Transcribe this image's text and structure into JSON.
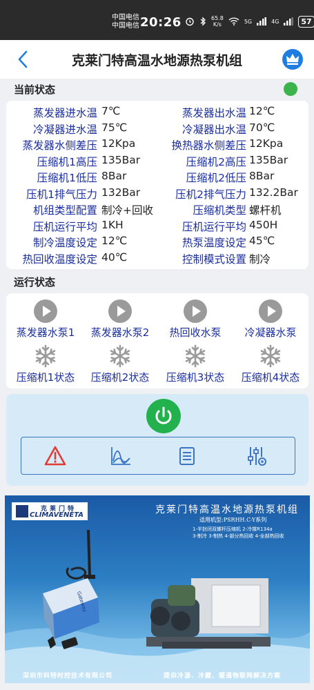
{
  "status_bar": {
    "carrier_1": "中国电信",
    "carrier_2": "中国电信",
    "time": "20:26",
    "net_speed_value": "65.8",
    "net_speed_unit": "K/s",
    "signal_5g": "5G",
    "signal_4g": "4G",
    "battery": "57"
  },
  "header": {
    "title": "克莱门特高温水地源热泵机组"
  },
  "current_status": {
    "label": "当前状态",
    "rows": [
      {
        "l1": "蒸发器进水温",
        "v1": "7℃",
        "l2": "蒸发器出水温",
        "v2": "12℃"
      },
      {
        "l1": "冷凝器进水温",
        "v1": "75℃",
        "l2": "冷凝器出水温",
        "v2": "70℃"
      },
      {
        "l1": "蒸发器水侧差压",
        "v1": "12Kpa",
        "l2": "换热器水侧差压",
        "v2": "12Kpa"
      },
      {
        "l1": "压缩机1高压",
        "v1": "135Bar",
        "l2": "压缩机2高压",
        "v2": "135Bar"
      },
      {
        "l1": "压缩机1低压",
        "v1": "8Bar",
        "l2": "压缩机2低压",
        "v2": "8Bar"
      },
      {
        "l1": "压机1排气压力",
        "v1": "132Bar",
        "l2": "压机2排气压力",
        "v2": "132.2Bar"
      },
      {
        "l1": "机组类型配置",
        "v1": "制冷+回收",
        "l2": "压缩机类型",
        "v2": "螺杆机"
      },
      {
        "l1": "压机运行平均",
        "v1": "1KH",
        "l2": "压机运行平均",
        "v2": "450H"
      },
      {
        "l1": "制冷温度设定",
        "v1": "12℃",
        "l2": "热泵温度设定",
        "v2": "45℃"
      },
      {
        "l1": "热回收温度设定",
        "v1": "40℃",
        "l2": "控制模式设置",
        "v2": "制冷"
      }
    ]
  },
  "run_status": {
    "label": "运行状态",
    "pumps": [
      {
        "label": "蒸发器水泵1",
        "icon": "play-circle-icon"
      },
      {
        "label": "蒸发器水泵2",
        "icon": "play-circle-icon"
      },
      {
        "label": "热回收水泵",
        "icon": "play-circle-icon"
      },
      {
        "label": "冷凝器水泵",
        "icon": "play-circle-icon"
      }
    ],
    "compressors": [
      {
        "label": "压缩机1状态",
        "icon": "snowflake-icon"
      },
      {
        "label": "压缩机2状态",
        "icon": "snowflake-icon"
      },
      {
        "label": "压缩机3状态",
        "icon": "snowflake-icon"
      },
      {
        "label": "压缩机4状态",
        "icon": "snowflake-icon"
      }
    ]
  },
  "controls": {
    "power_icon": "power-icon",
    "tools": [
      "alarm-icon",
      "trend-chart-icon",
      "list-icon",
      "settings-sliders-icon"
    ]
  },
  "banner": {
    "logo_cn": "克莱门特",
    "logo_en": "CLIMAVENETA",
    "title": "克莱门特高温水地源热泵机组",
    "model": "适用机型:PSRHH.C-Y系列",
    "feature_line_1": "1-半封闭双螺杆压缩机 2-冷媒R134a",
    "feature_line_2": "3-制冷 3-制热 4-部分热回收 4-全部热回收",
    "gateway_label": "Gateway",
    "company": "深圳市科特时控技术有限公司",
    "slogan": "提供冷源、冷藏、暖通物联网解决方案"
  },
  "colors": {
    "label_blue": "#1a2ea0",
    "status_online": "#3cb44b",
    "power_green": "#22b14c",
    "alarm_red": "#e53935",
    "tool_blue": "#3b74c4",
    "header_crown": "#1f7de0"
  }
}
